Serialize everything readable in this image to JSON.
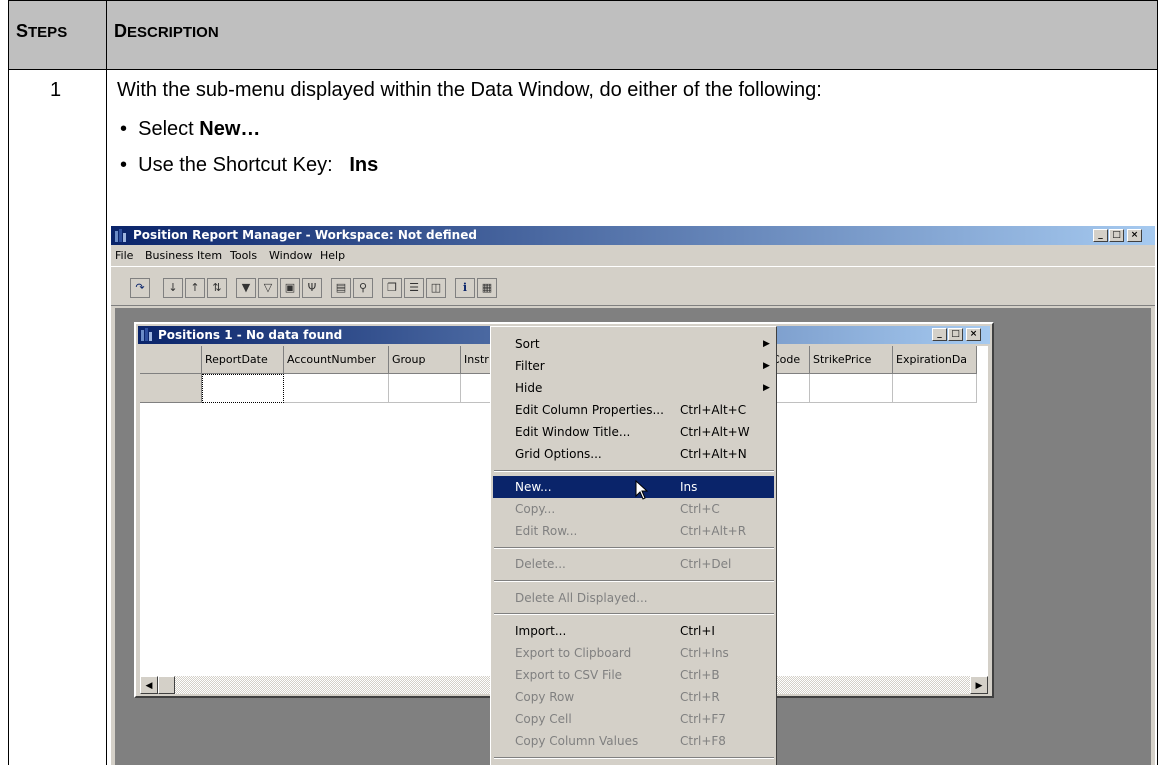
{
  "table": {
    "header_steps_first": "S",
    "header_steps_rest": "TEPS",
    "header_desc_first": "D",
    "header_desc_rest": "ESCRIPTION",
    "step_number": "1",
    "description": "With the sub-menu displayed within the Data Window, do either of the following:",
    "bullet1_prefix": "Select ",
    "bullet1_bold": "New…",
    "bullet2_prefix": "Use the Shortcut Key:   ",
    "bullet2_bold": "Ins"
  },
  "app": {
    "title": "Position Report Manager - Workspace: Not defined",
    "menu": [
      "File",
      "Business Item",
      "Tools",
      "Window",
      "Help"
    ],
    "window_buttons": [
      "_",
      "□",
      "×"
    ]
  },
  "child": {
    "title": "Positions 1 - No data found",
    "columns": [
      "",
      "ReportDate",
      "AccountNumber",
      "Group",
      "Instr",
      "Code",
      "StrikePrice",
      "ExpirationDa"
    ]
  },
  "context_menu": {
    "items": [
      {
        "label": "Sort",
        "shortcut": "",
        "submenu": true,
        "disabled": false
      },
      {
        "label": "Filter",
        "shortcut": "",
        "submenu": true,
        "disabled": false
      },
      {
        "label": "Hide",
        "shortcut": "",
        "submenu": true,
        "disabled": false
      },
      {
        "label": "Edit Column Properties...",
        "shortcut": "Ctrl+Alt+C",
        "submenu": false,
        "disabled": false
      },
      {
        "label": "Edit Window Title...",
        "shortcut": "Ctrl+Alt+W",
        "submenu": false,
        "disabled": false
      },
      {
        "label": "Grid Options...",
        "shortcut": "Ctrl+Alt+N",
        "submenu": false,
        "disabled": false
      },
      {
        "label": "New...",
        "shortcut": "Ins",
        "submenu": false,
        "disabled": false,
        "highlighted": true
      },
      {
        "label": "Copy...",
        "shortcut": "Ctrl+C",
        "submenu": false,
        "disabled": true
      },
      {
        "label": "Edit Row...",
        "shortcut": "Ctrl+Alt+R",
        "submenu": false,
        "disabled": true
      },
      {
        "label": "Delete...",
        "shortcut": "Ctrl+Del",
        "submenu": false,
        "disabled": true
      },
      {
        "label": "Delete All Displayed...",
        "shortcut": "",
        "submenu": false,
        "disabled": true
      },
      {
        "label": "Import...",
        "shortcut": "Ctrl+I",
        "submenu": false,
        "disabled": false
      },
      {
        "label": "Export to Clipboard",
        "shortcut": "Ctrl+Ins",
        "submenu": false,
        "disabled": true
      },
      {
        "label": "Export to CSV File",
        "shortcut": "Ctrl+B",
        "submenu": false,
        "disabled": true
      },
      {
        "label": "Copy Row",
        "shortcut": "Ctrl+R",
        "submenu": false,
        "disabled": true
      },
      {
        "label": "Copy Cell",
        "shortcut": "Ctrl+F7",
        "submenu": false,
        "disabled": true
      },
      {
        "label": "Copy Column Values",
        "shortcut": "Ctrl+F8",
        "submenu": false,
        "disabled": true
      }
    ]
  },
  "colors": {
    "header_bg": "#bfbfbf",
    "titlebar": "#0a246a",
    "highlight": "#0a246a",
    "face": "#d4d0c8",
    "mdi_bg": "#808080"
  }
}
